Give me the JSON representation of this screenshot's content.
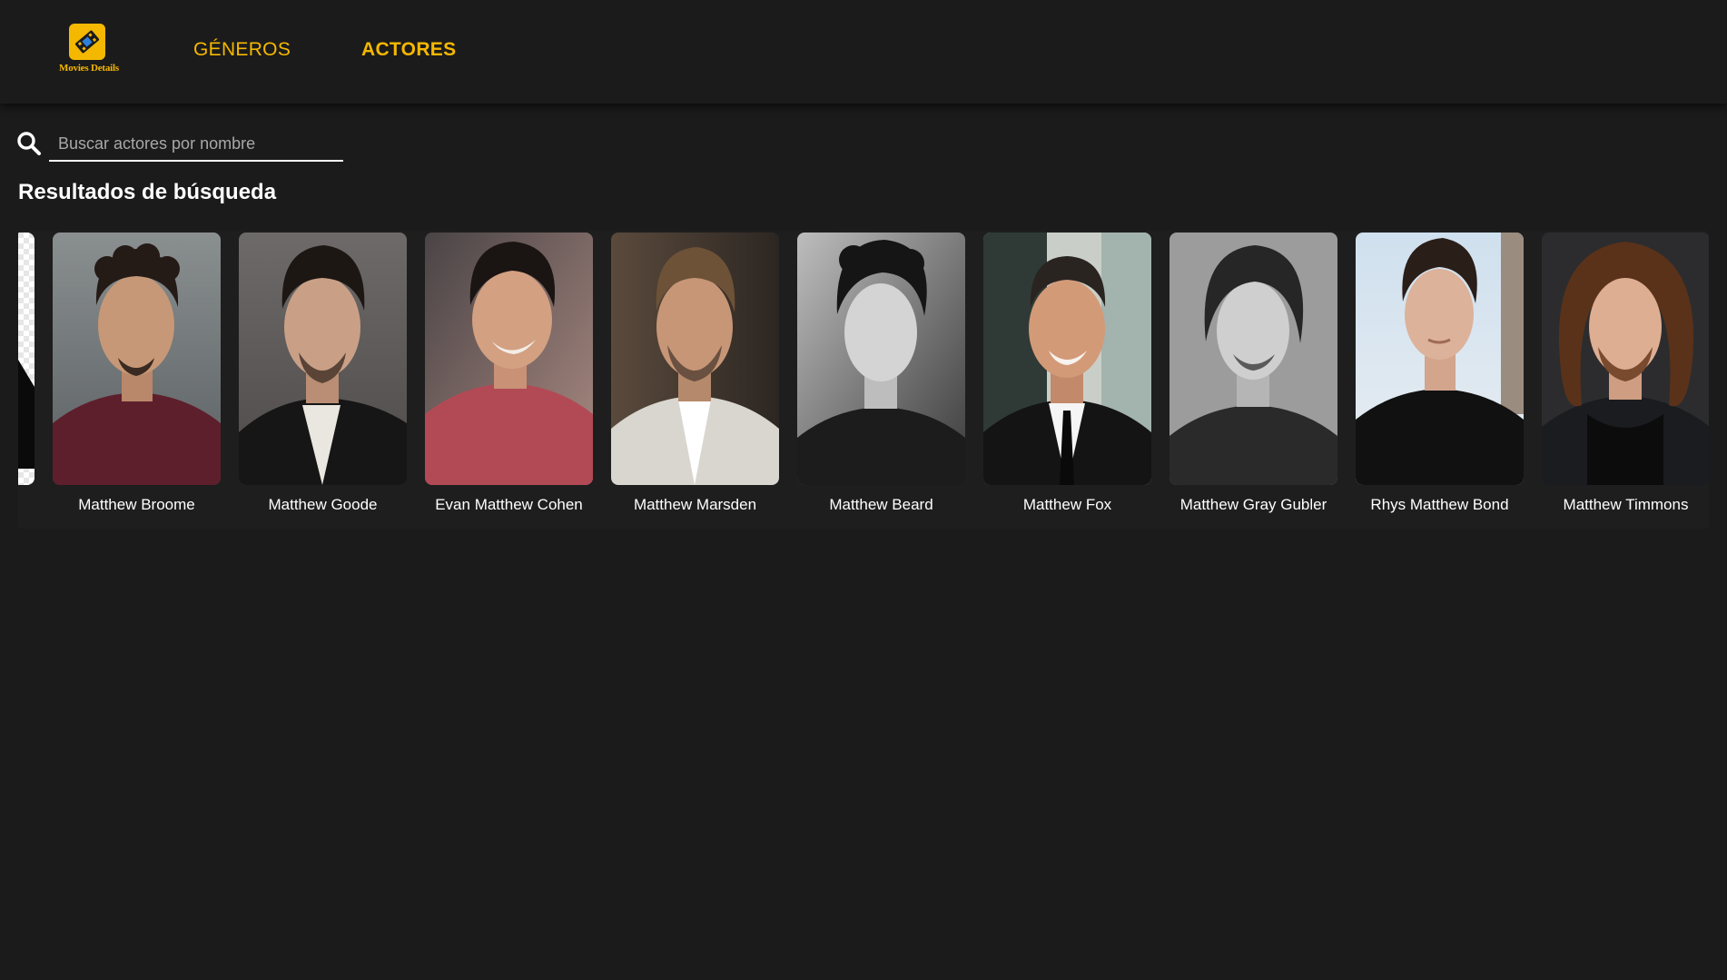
{
  "brand": {
    "logo_text": "Movies Details"
  },
  "nav": {
    "items": [
      {
        "label": "GÉNEROS"
      },
      {
        "label": "ACTORES"
      }
    ]
  },
  "search": {
    "value": "",
    "placeholder": "Buscar actores por nombre"
  },
  "results": {
    "title": "Resultados de búsqueda",
    "actors": [
      {
        "name": "Matthew Broome",
        "photo_style": "color"
      },
      {
        "name": "Matthew Goode",
        "photo_style": "color"
      },
      {
        "name": "Evan Matthew Cohen",
        "photo_style": "color"
      },
      {
        "name": "Matthew Marsden",
        "photo_style": "color"
      },
      {
        "name": "Matthew Beard",
        "photo_style": "black-and-white"
      },
      {
        "name": "Matthew Fox",
        "photo_style": "color"
      },
      {
        "name": "Matthew Gray Gubler",
        "photo_style": "black-and-white"
      },
      {
        "name": "Rhys Matthew Bond",
        "photo_style": "color"
      },
      {
        "name": "Matthew Timmons",
        "photo_style": "color"
      }
    ]
  },
  "colors": {
    "background": "#1b1b1b",
    "accent": "#f5b800",
    "text": "#ffffff",
    "placeholder": "#a8a8a8"
  },
  "icons": {
    "search": "search-icon",
    "logo": "film-ticket-icon"
  }
}
